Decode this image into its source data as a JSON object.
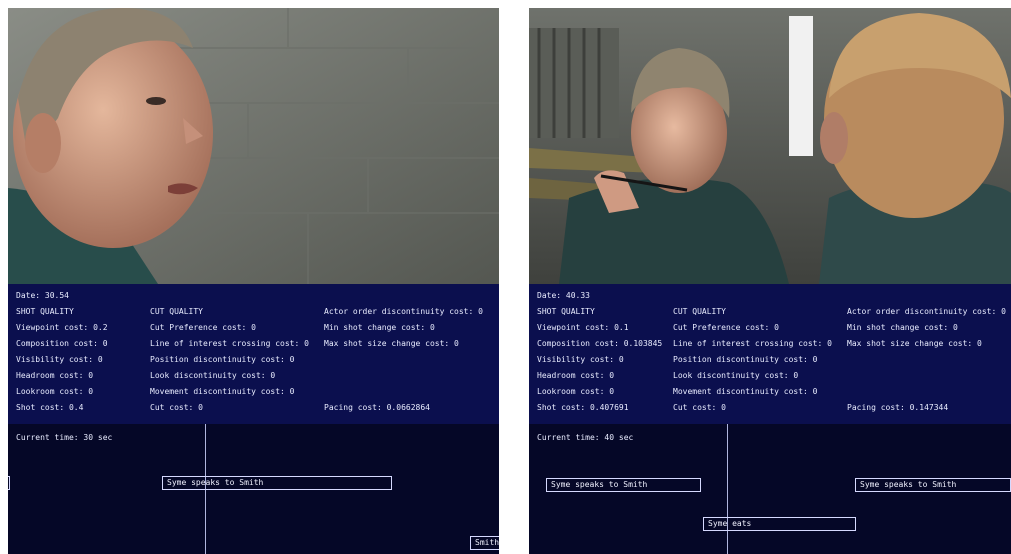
{
  "panels": {
    "left": {
      "date": "Date: 30.54",
      "shot_quality": {
        "header": "SHOT QUALITY",
        "viewpoint": "Viewpoint cost: 0.2",
        "composition": "Composition cost: 0",
        "visibility": "Visibility cost: 0",
        "headroom": "Headroom cost: 0",
        "lookroom": "Lookroom cost: 0",
        "shot": "Shot cost: 0.4"
      },
      "cut_quality": {
        "header": "CUT QUALITY",
        "preference": "Cut Preference cost: 0",
        "line_of_interest": "Line of interest crossing cost: 0",
        "position": "Position discontinuity cost: 0",
        "look": "Look discontinuity cost: 0",
        "movement": "Movement discontinuity cost: 0",
        "cut": "Cut cost: 0"
      },
      "other": {
        "actor_order": "Actor order discontinuity cost: 0",
        "min_shot_change": "Min shot change cost: 0",
        "max_shot_size_change": "Max shot size change cost: 0",
        "pacing": "Pacing cost: 0.0662864"
      },
      "timeline": {
        "current_time": "Current time: 30 sec",
        "clips": [
          {
            "label": ""
          },
          {
            "label": "Syme speaks to Smith"
          },
          {
            "label": "Smith"
          }
        ]
      }
    },
    "right": {
      "date": "Date: 40.33",
      "shot_quality": {
        "header": "SHOT QUALITY",
        "viewpoint": "Viewpoint cost: 0.1",
        "composition": "Composition cost: 0.103845",
        "visibility": "Visibility cost: 0",
        "headroom": "Headroom cost: 0",
        "lookroom": "Lookroom cost: 0",
        "shot": "Shot cost: 0.407691"
      },
      "cut_quality": {
        "header": "CUT QUALITY",
        "preference": "Cut Preference cost: 0",
        "line_of_interest": "Line of interest crossing cost: 0",
        "position": "Position discontinuity cost: 0",
        "look": "Look discontinuity cost: 0",
        "movement": "Movement discontinuity cost: 0",
        "cut": "Cut cost: 0"
      },
      "other": {
        "actor_order": "Actor order discontinuity cost: 0",
        "min_shot_change": "Min shot change cost: 0",
        "max_shot_size_change": "Max shot size change cost: 0",
        "pacing": "Pacing cost: 0.147344"
      },
      "timeline": {
        "current_time": "Current time: 40 sec",
        "clips": [
          {
            "label": "Syme speaks to Smith"
          },
          {
            "label": "Syme speaks to Smith"
          },
          {
            "label": "Syme eats"
          }
        ]
      }
    }
  }
}
